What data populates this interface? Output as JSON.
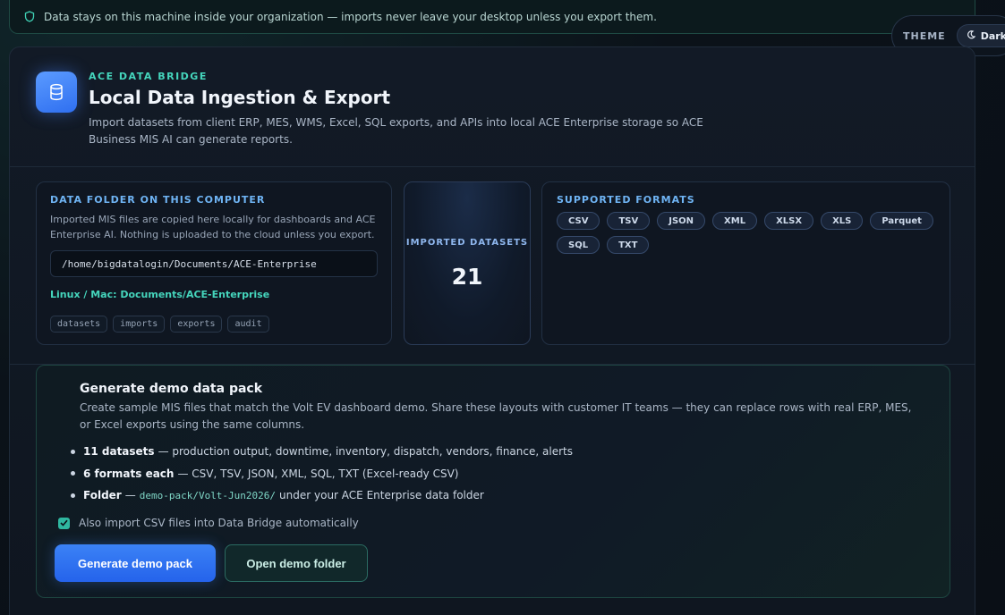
{
  "banner": {
    "text": "Data stays on this machine inside your organization — imports never leave your desktop unless you export them."
  },
  "theme": {
    "label": "THEME",
    "value": "Dark"
  },
  "header": {
    "eyebrow": "ACE DATA BRIDGE",
    "title": "Local Data Ingestion & Export",
    "description": "Import datasets from client ERP, MES, WMS, Excel, SQL exports, and APIs into local ACE Enterprise storage so ACE Business MIS AI can generate reports."
  },
  "folder": {
    "heading": "DATA FOLDER ON THIS COMPUTER",
    "note": "Imported MIS files are copied here locally for dashboards and ACE Enterprise AI. Nothing is uploaded to the cloud unless you export.",
    "path": "/home/bigdatalogin/Documents/ACE-Enterprise",
    "os_hint": "Linux / Mac: Documents/ACE-Enterprise",
    "subfolders": [
      "datasets",
      "imports",
      "exports",
      "audit"
    ]
  },
  "stats": {
    "label": "IMPORTED DATASETS",
    "value": "21"
  },
  "formats": {
    "heading": "SUPPORTED FORMATS",
    "items": [
      "CSV",
      "TSV",
      "JSON",
      "XML",
      "XLSX",
      "XLS",
      "Parquet",
      "SQL",
      "TXT"
    ]
  },
  "demo": {
    "title": "Generate demo data pack",
    "description": "Create sample MIS files that match the Volt EV dashboard demo. Share these layouts with customer IT teams — they can replace rows with real ERP, MES, or Excel exports using the same columns.",
    "bullets": [
      {
        "bold": "11 datasets",
        "text": "— production output, downtime, inventory, dispatch, vendors, finance, alerts"
      },
      {
        "bold": "6 formats each",
        "text": "— CSV, TSV, JSON, XML, SQL, TXT (Excel-ready CSV)"
      },
      {
        "bold": "Folder",
        "text": "—",
        "code": "demo-pack/Volt-Jun2026/",
        "after": "under your ACE Enterprise data folder"
      }
    ],
    "checkbox_label": "Also import CSV files into Data Bridge automatically",
    "checkbox_checked": true,
    "primary_button": "Generate demo pack",
    "secondary_button": "Open demo folder"
  },
  "colors": {
    "accent_teal": "#45d6bd",
    "accent_blue": "#3b82f6",
    "background": "#0b1219"
  }
}
